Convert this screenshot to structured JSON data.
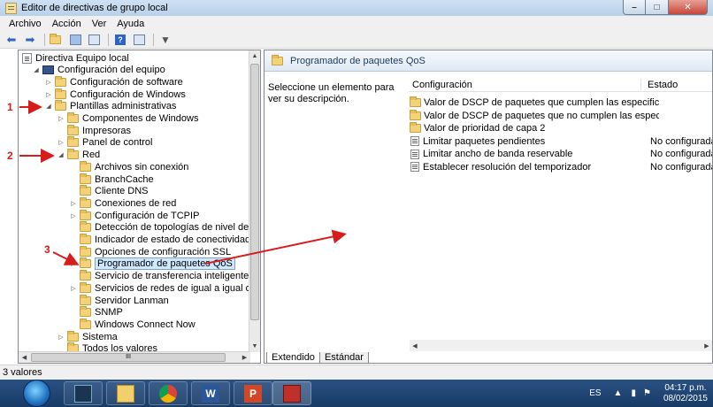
{
  "window": {
    "title": "Editor de directivas de grupo local",
    "minimize_glyph": "–",
    "maximize_glyph": "□",
    "close_glyph": "✕"
  },
  "menu": [
    "Archivo",
    "Acción",
    "Ver",
    "Ayuda"
  ],
  "toolbar": {
    "icons": [
      "back-arrow-icon",
      "forward-arrow-icon",
      "up-folder-icon",
      "show-hide-tree-icon",
      "export-list-icon",
      "help-icon",
      "properties-icon",
      "filter-icon"
    ]
  },
  "tree": {
    "items": [
      {
        "label": "Directiva Equipo local",
        "level": 0,
        "icon": "policy-doc-icon",
        "expander": ""
      },
      {
        "label": "Configuración del equipo",
        "level": 1,
        "icon": "computer-icon",
        "expander": "◢"
      },
      {
        "label": "Configuración de software",
        "level": 2,
        "icon": "folder-icon",
        "expander": "▷"
      },
      {
        "label": "Configuración de Windows",
        "level": 2,
        "icon": "folder-icon",
        "expander": "▷"
      },
      {
        "label": "Plantillas administrativas",
        "level": 2,
        "icon": "folder-icon",
        "expander": "◢"
      },
      {
        "label": "Componentes de Windows",
        "level": 3,
        "icon": "folder-icon",
        "expander": "▷"
      },
      {
        "label": "Impresoras",
        "level": 3,
        "icon": "folder-icon",
        "expander": ""
      },
      {
        "label": "Panel de control",
        "level": 3,
        "icon": "folder-icon",
        "expander": "▷"
      },
      {
        "label": "Red",
        "level": 3,
        "icon": "folder-icon",
        "expander": "◢"
      },
      {
        "label": "Archivos sin conexión",
        "level": 4,
        "icon": "folder-icon",
        "expander": ""
      },
      {
        "label": "BranchCache",
        "level": 4,
        "icon": "folder-icon",
        "expander": ""
      },
      {
        "label": "Cliente DNS",
        "level": 4,
        "icon": "folder-icon",
        "expander": ""
      },
      {
        "label": "Conexiones de red",
        "level": 4,
        "icon": "folder-icon",
        "expander": "▷"
      },
      {
        "label": "Configuración de TCPIP",
        "level": 4,
        "icon": "folder-icon",
        "expander": "▷"
      },
      {
        "label": "Detección de topologías de nivel de vínculo",
        "level": 4,
        "icon": "folder-icon",
        "expander": ""
      },
      {
        "label": "Indicador de estado de conectividad de red",
        "level": 4,
        "icon": "folder-icon",
        "expander": ""
      },
      {
        "label": "Opciones de configuración SSL",
        "level": 4,
        "icon": "folder-icon",
        "expander": ""
      },
      {
        "label": "Programador de paquetes QoS",
        "level": 4,
        "icon": "folder-icon",
        "expander": "▷",
        "selected": true
      },
      {
        "label": "Servicio de transferencia inteligente en segur",
        "level": 4,
        "icon": "folder-icon",
        "expander": ""
      },
      {
        "label": "Servicios de redes de igual a igual de Microsc",
        "level": 4,
        "icon": "folder-icon",
        "expander": "▷"
      },
      {
        "label": "Servidor Lanman",
        "level": 4,
        "icon": "folder-icon",
        "expander": ""
      },
      {
        "label": "SNMP",
        "level": 4,
        "icon": "folder-icon",
        "expander": ""
      },
      {
        "label": "Windows Connect Now",
        "level": 4,
        "icon": "folder-icon",
        "expander": ""
      },
      {
        "label": "Sistema",
        "level": 3,
        "icon": "folder-icon",
        "expander": "▷"
      },
      {
        "label": "Todos los valores",
        "level": 3,
        "icon": "folder-icon",
        "expander": ""
      }
    ],
    "hscroll_thumb": "III"
  },
  "right": {
    "header": "Programador de paquetes QoS",
    "description": "Seleccione un elemento para ver su descripción.",
    "columns": [
      "Configuración",
      "Estado"
    ],
    "rows": [
      {
        "name": "Valor de DSCP de paquetes que cumplen las especificaciones",
        "state": "",
        "icon": "folder-icon"
      },
      {
        "name": "Valor de DSCP de paquetes que no cumplen las especificaci...",
        "state": "",
        "icon": "folder-icon"
      },
      {
        "name": "Valor de prioridad de capa 2",
        "state": "",
        "icon": "folder-icon"
      },
      {
        "name": "Limitar paquetes pendientes",
        "state": "No configurada",
        "icon": "setting-icon"
      },
      {
        "name": "Limitar ancho de banda reservable",
        "state": "No configurada",
        "icon": "setting-icon"
      },
      {
        "name": "Establecer resolución del temporizador",
        "state": "No configurada",
        "icon": "setting-icon"
      }
    ],
    "tabs": [
      "Extendido",
      "Estándar"
    ]
  },
  "status": "3 valores",
  "taskbar": {
    "apps": [
      "start-orb-icon",
      "ide-app-icon",
      "file-explorer-icon",
      "chrome-icon",
      "word-icon",
      "powerpoint-icon",
      "toolbox-app-icon"
    ],
    "lang": "ES",
    "time": "04:17 p.m.",
    "date": "08/02/2015"
  },
  "annotations": {
    "marker_1": "1",
    "marker_2": "2",
    "marker_3": "3",
    "color": "#d81c1c"
  }
}
